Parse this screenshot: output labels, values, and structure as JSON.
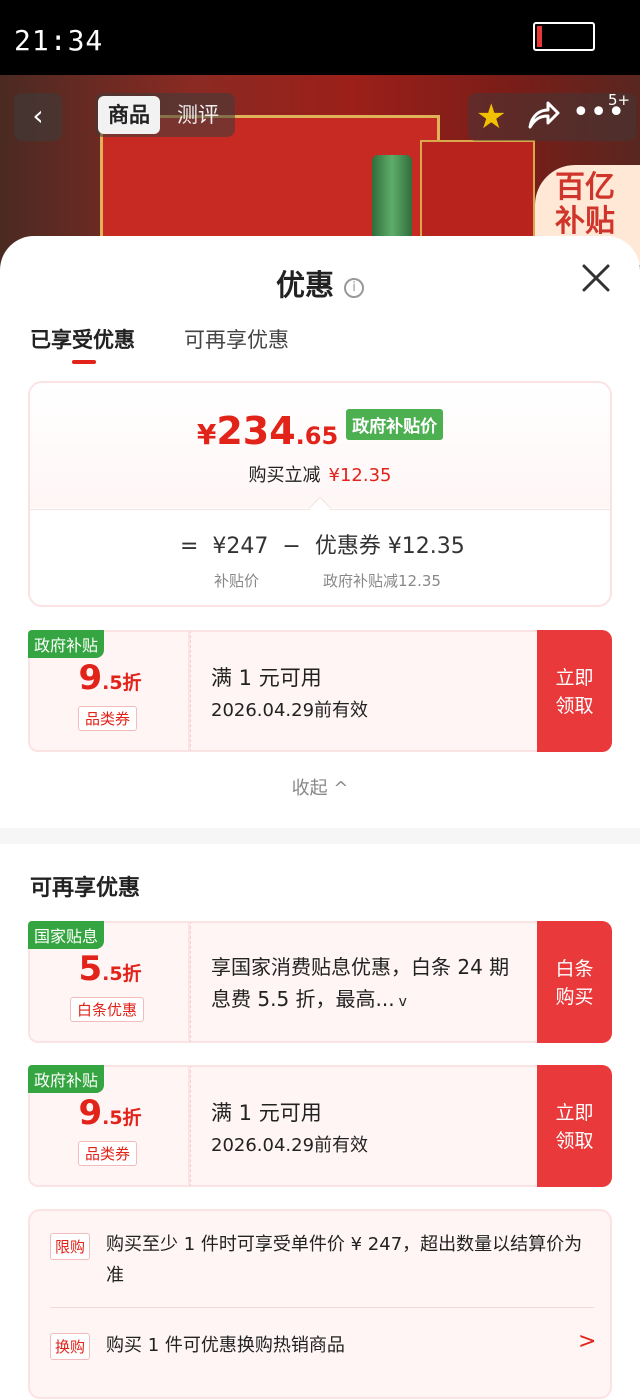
{
  "status_bar": {
    "time": "21:34",
    "battery_level": 0.1
  },
  "product_header": {
    "tab_product": "商品",
    "tab_review": "测评",
    "more_badge": "5+",
    "subsidy_tag": "百亿\n补贴"
  },
  "sheet": {
    "title": "优惠",
    "tabs": {
      "enjoyed": "已享受优惠",
      "more": "可再享优惠"
    }
  },
  "summary": {
    "currency": "¥",
    "price_int": "234",
    "price_dec": ".65",
    "price_tag": "政府补贴价",
    "reduce_label": "购买立减",
    "reduce_amount": "¥12.35",
    "equation": "=  ¥247  −  优惠券 ¥12.35",
    "sub_left": "补贴价",
    "sub_right": "政府补贴减12.35"
  },
  "enjoyed_coupon": {
    "corner": "政府补贴",
    "disc_big": "9",
    "disc_small": ".5折",
    "category": "品类券",
    "line1": "满 1 元可用",
    "line2": "2026.04.29前有效",
    "button": "立即\n领取"
  },
  "collapse": "收起 ^",
  "more_section": {
    "title": "可再享优惠",
    "coupons": [
      {
        "corner": "国家贴息",
        "disc_big": "5",
        "disc_small": ".5折",
        "category": "白条优惠",
        "desc": "享国家消费贴息优惠，白条 24 期息费 5.5 折，最高...",
        "chevron": "v",
        "button": "白条\n购买"
      },
      {
        "corner": "政府补贴",
        "disc_big": "9",
        "disc_small": ".5折",
        "category": "品类券",
        "line1": "满 1 元可用",
        "line2": "2026.04.29前有效",
        "button": "立即\n领取"
      }
    ]
  },
  "info_card": {
    "limit_tag": "限购",
    "limit_text": "购买至少 1 件时可享受单件价 ¥ 247，超出数量以结算价为准",
    "swap_tag": "换购",
    "swap_text": "购买 1 件可优惠换购热销商品",
    "chevron": ">"
  },
  "colors": {
    "accent": "#e2231a",
    "green": "#35a541",
    "button": "#e9393b"
  }
}
